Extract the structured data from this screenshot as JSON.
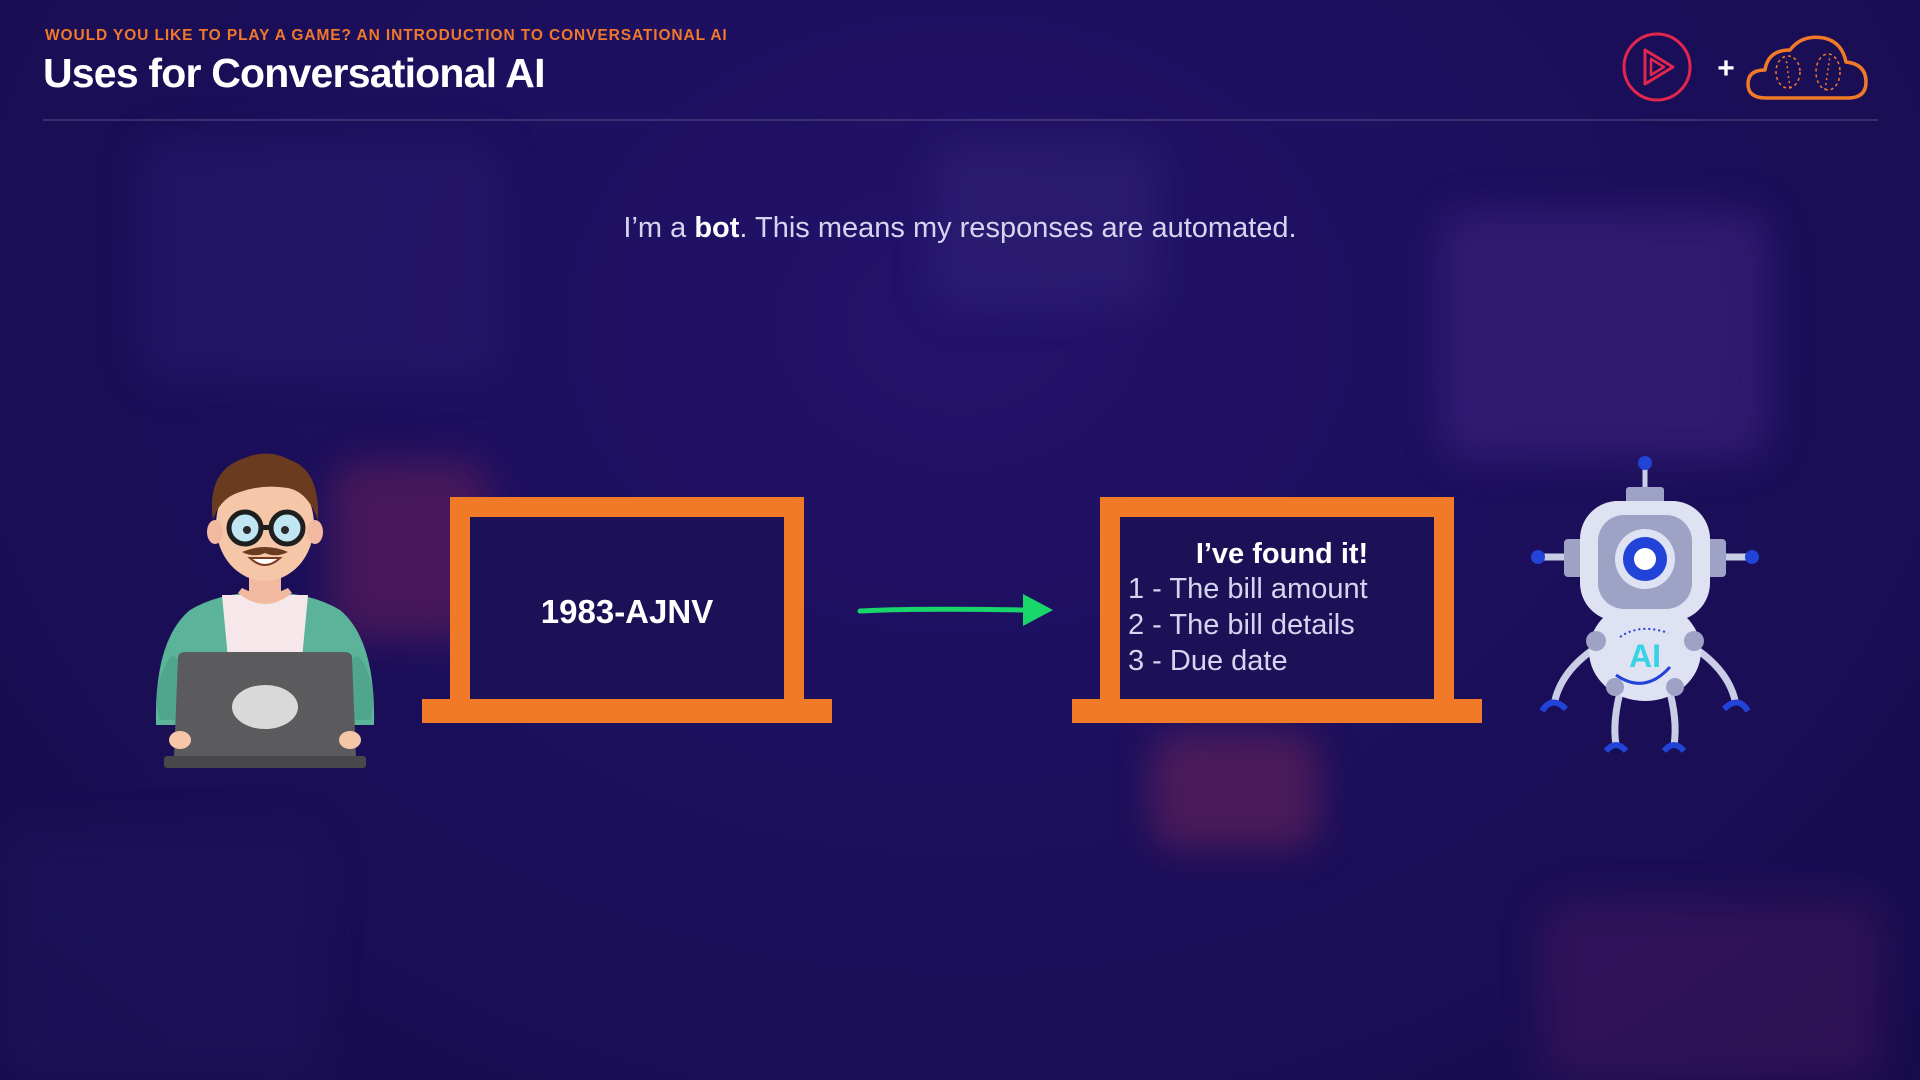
{
  "header": {
    "subtitle": "WOULD YOU LIKE TO PLAY A GAME? AN INTRODUCTION TO CONVERSATIONAL AI",
    "title": "Uses for Conversational AI",
    "plus": "+"
  },
  "caption": {
    "prefix": "I’m a ",
    "bold": "bot",
    "suffix": ". This means my responses are automated."
  },
  "left_screen": {
    "code": "1983-AJNV"
  },
  "right_screen": {
    "title": "I’ve found it!",
    "items": [
      "1 - The bill amount",
      "2 - The bill details",
      "3 - Due date"
    ]
  },
  "robot": {
    "chest_label": "AI"
  },
  "colors": {
    "accent": "#f07a28",
    "arrow": "#19d66b",
    "brand_red": "#e2264d",
    "background": "#1c0f5c"
  },
  "icons": [
    "play-logo-icon",
    "cloud-logo-icon",
    "person-illustration",
    "robot-illustration",
    "arrow-icon"
  ]
}
